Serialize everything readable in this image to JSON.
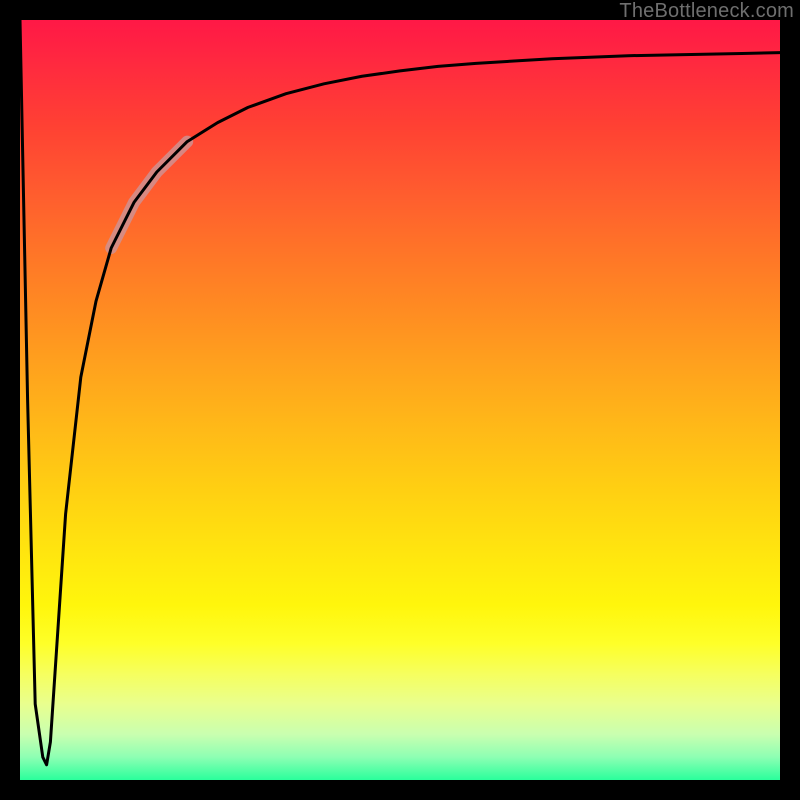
{
  "attribution": "TheBottleneck.com",
  "chart_data": {
    "type": "line",
    "title": "",
    "xlabel": "",
    "ylabel": "",
    "xlim": [
      0,
      100
    ],
    "ylim": [
      0,
      100
    ],
    "grid": false,
    "series": [
      {
        "name": "curve",
        "stroke": "#000000",
        "width": 3,
        "x": [
          0,
          1,
          2,
          3,
          3.5,
          4,
          5,
          6,
          8,
          10,
          12,
          15,
          18,
          22,
          26,
          30,
          35,
          40,
          45,
          50,
          55,
          60,
          65,
          70,
          75,
          80,
          85,
          90,
          95,
          100
        ],
        "y": [
          100,
          50,
          10,
          3,
          2,
          5,
          20,
          35,
          53,
          63,
          70,
          76,
          80,
          84,
          86.5,
          88.5,
          90.3,
          91.6,
          92.6,
          93.3,
          93.9,
          94.3,
          94.6,
          94.9,
          95.1,
          95.3,
          95.4,
          95.5,
          95.6,
          95.7
        ]
      }
    ],
    "highlight": {
      "stroke": "#d09090",
      "width": 12,
      "x": [
        12,
        15,
        18,
        22
      ],
      "y": [
        70,
        76,
        80,
        84
      ]
    },
    "gradient_stops": [
      {
        "pos": 0,
        "color": "#ff1846"
      },
      {
        "pos": 6,
        "color": "#ff2a3f"
      },
      {
        "pos": 14,
        "color": "#ff4133"
      },
      {
        "pos": 22,
        "color": "#ff5a2f"
      },
      {
        "pos": 30,
        "color": "#ff7328"
      },
      {
        "pos": 38,
        "color": "#ff8b22"
      },
      {
        "pos": 46,
        "color": "#ffa31d"
      },
      {
        "pos": 54,
        "color": "#ffba18"
      },
      {
        "pos": 62,
        "color": "#ffd012"
      },
      {
        "pos": 70,
        "color": "#ffe50f"
      },
      {
        "pos": 77,
        "color": "#fff60c"
      },
      {
        "pos": 82,
        "color": "#feff28"
      },
      {
        "pos": 86,
        "color": "#f6ff5e"
      },
      {
        "pos": 90,
        "color": "#e9ff8e"
      },
      {
        "pos": 94,
        "color": "#c9ffb0"
      },
      {
        "pos": 97,
        "color": "#8dffb3"
      },
      {
        "pos": 100,
        "color": "#2aff9c"
      }
    ]
  }
}
